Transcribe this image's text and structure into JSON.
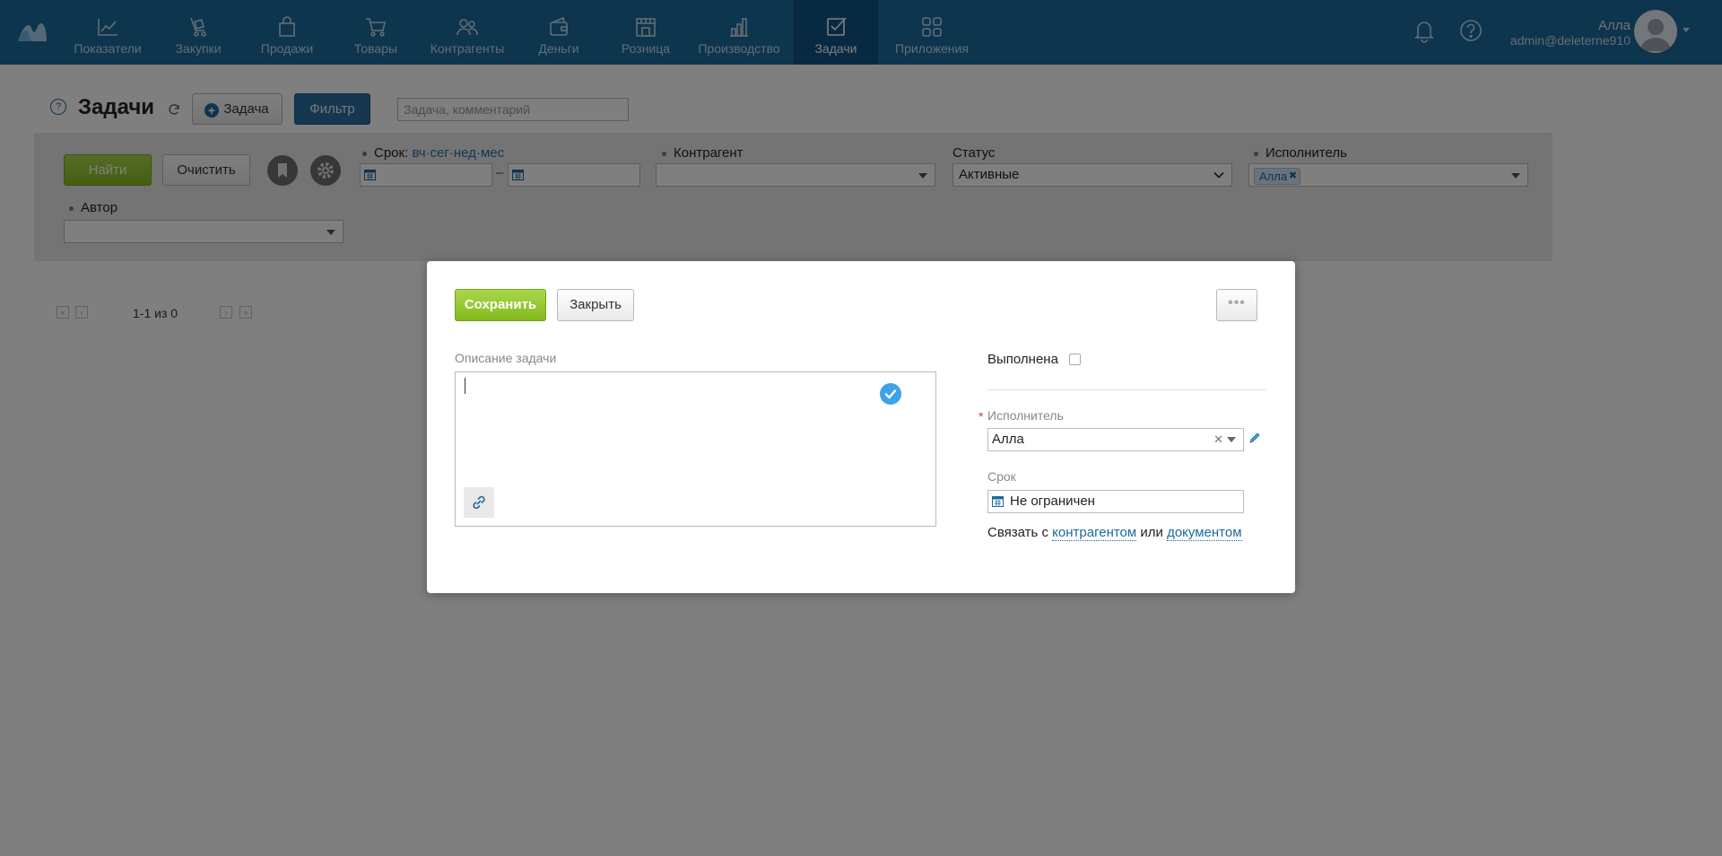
{
  "nav": {
    "items": [
      {
        "label": "Показатели",
        "icon": "chart-line-icon"
      },
      {
        "label": "Закупки",
        "icon": "shopping-trolley-icon"
      },
      {
        "label": "Продажи",
        "icon": "shopping-bag-icon"
      },
      {
        "label": "Товары",
        "icon": "cart-icon"
      },
      {
        "label": "Контрагенты",
        "icon": "people-icon"
      },
      {
        "label": "Деньги",
        "icon": "wallet-icon"
      },
      {
        "label": "Розница",
        "icon": "store-icon"
      },
      {
        "label": "Производство",
        "icon": "factory-icon"
      },
      {
        "label": "Задачи",
        "icon": "task-check-icon",
        "active": true
      },
      {
        "label": "Приложения",
        "icon": "apps-grid-icon"
      }
    ],
    "user_name": "Алла",
    "user_email": "admin@deleterne910"
  },
  "page": {
    "title": "Задачи",
    "help": "?",
    "add_task_label": "Задача",
    "filter_label": "Фильтр",
    "search_placeholder": "Задача, комментарий"
  },
  "filters": {
    "find_label": "Найти",
    "clear_label": "Очистить",
    "deadline_label": "Срок:",
    "periods": [
      "вч",
      "сег",
      "нед",
      "мес"
    ],
    "period_sep": "·",
    "range_dash": "–",
    "counterparty_label": "Контрагент",
    "status_label": "Статус",
    "status_value": "Активные",
    "assignee_label": "Исполнитель",
    "assignee_tag": "Алла",
    "author_label": "Автор"
  },
  "pager": {
    "text": "1-1 из 0"
  },
  "dialog": {
    "save_label": "Сохранить",
    "close_label": "Закрыть",
    "more_label": "•••",
    "description_label": "Описание задачи",
    "description_value": "",
    "done_label": "Выполнена",
    "done_checked": false,
    "assignee_label": "Исполнитель",
    "assignee_value": "Алла",
    "deadline_label": "Срок",
    "deadline_value": "Не ограничен",
    "link_prefix": "Связать с",
    "link_counterparty": "контрагентом",
    "link_or": "или",
    "link_document": "документом"
  },
  "colors": {
    "topbar": "#1b6a9c",
    "active_nav": "#0e5584",
    "accent_green": "#8cc02a",
    "link_blue": "#1b6a9c",
    "check_blue": "#3fa2e8"
  }
}
